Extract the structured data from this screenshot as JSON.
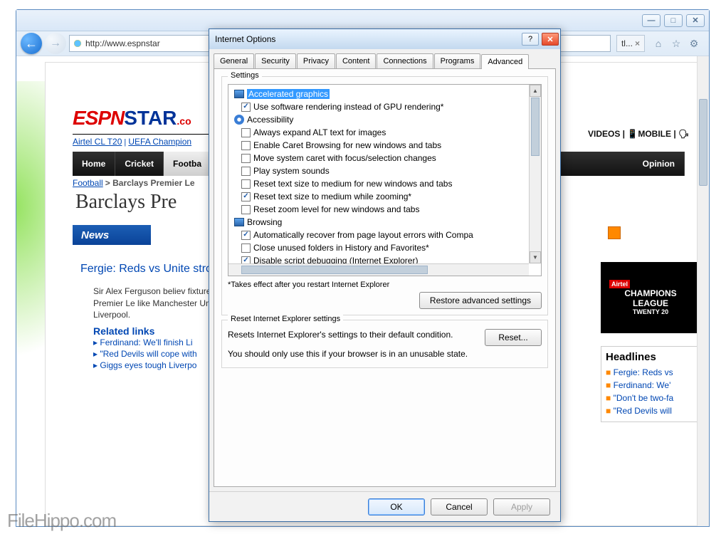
{
  "window": {
    "min": "—",
    "max": "□",
    "close": "✕"
  },
  "toolbar": {
    "url": "http://www.espnstar",
    "tab_label": "tl...",
    "tab_close": "×"
  },
  "page": {
    "logo_espn": "ESPN",
    "logo_star": "STAR",
    "logo_com": ".co",
    "link1": "Airtel CL T20",
    "link2": "UEFA Champion",
    "nav": [
      "Home",
      "Cricket",
      "Footba"
    ],
    "opinion": "Opinion",
    "crumb_a": "Football",
    "crumb_b": "> Barclays Premier Le",
    "title": "Barclays Pre",
    "news": "News",
    "nb_right": "Barclays Premier Le",
    "story_h": "Fergie: Reds vs Unite strong",
    "story_p": "Sir Alex Ferguson believ fixture in the Premier Le like Manchester United a Liverpool.",
    "related": "Related links",
    "rl": [
      "Ferdinand: We'll finish Li",
      "\"Red Devils will cope with",
      "Giggs eyes tough Liverpo"
    ],
    "r_videos": "VIDEOS |",
    "r_mobile": "📱MOBILE | 🗣",
    "ad_air": "Airtel",
    "ad_l1": "CHAMPIONS",
    "ad_l2": "LEAGUE",
    "ad_l3": "TWENTY 20",
    "head_title": "Headlines",
    "headlines": [
      "Fergie: Reds vs",
      "Ferdinand: We'",
      "\"Don't be two-fa",
      "\"Red Devils will"
    ]
  },
  "dialog": {
    "title": "Internet Options",
    "tabs": [
      "General",
      "Security",
      "Privacy",
      "Content",
      "Connections",
      "Programs",
      "Advanced"
    ],
    "settings_label": "Settings",
    "cats": {
      "accel": "Accelerated graphics",
      "access": "Accessibility",
      "browse": "Browsing"
    },
    "items": {
      "a1": "Use software rendering instead of GPU rendering*",
      "c1": "Always expand ALT text for images",
      "c2": "Enable Caret Browsing for new windows and tabs",
      "c3": "Move system caret with focus/selection changes",
      "c4": "Play system sounds",
      "c5": "Reset text size to medium for new windows and tabs",
      "c6": "Reset text size to medium while zooming*",
      "c7": "Reset zoom level for new windows and tabs",
      "b1": "Automatically recover from page layout errors with Compa",
      "b2": "Close unused folders in History and Favorites*",
      "b3": "Disable script debugging (Internet Explorer)"
    },
    "note": "*Takes effect after you restart Internet Explorer",
    "restore": "Restore advanced settings",
    "reset_label": "Reset Internet Explorer settings",
    "reset_txt": "Resets Internet Explorer's settings to their default condition.",
    "reset_warn": "You should only use this if your browser is in an unusable state.",
    "reset_btn": "Reset...",
    "ok": "OK",
    "cancel": "Cancel",
    "apply": "Apply",
    "help": "?",
    "close": "✕"
  },
  "watermark": "FileHippo.com"
}
